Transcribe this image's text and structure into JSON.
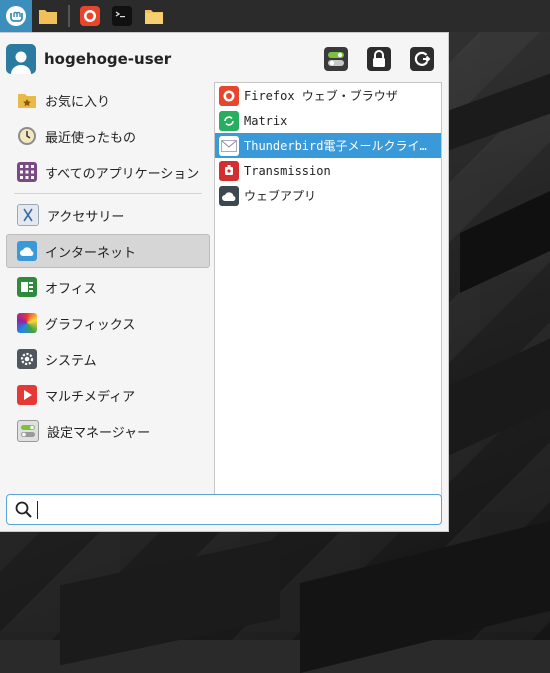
{
  "panel": {
    "icons": [
      "mint-menu-icon",
      "folder-icon",
      "firefox-icon",
      "terminal-icon",
      "folder-icon"
    ]
  },
  "user": {
    "name": "hogehoge-user"
  },
  "actions": [
    "settings-toggle-icon",
    "lock-icon",
    "logout-icon"
  ],
  "categories": [
    {
      "label": "お気に入り",
      "icon": "favorites-icon"
    },
    {
      "label": "最近使ったもの",
      "icon": "recent-icon"
    },
    {
      "label": "すべてのアプリケーション",
      "icon": "all-apps-icon"
    },
    {
      "label": "アクセサリー",
      "icon": "accessories-icon"
    },
    {
      "label": "インターネット",
      "icon": "internet-icon",
      "selected": true
    },
    {
      "label": "オフィス",
      "icon": "office-icon"
    },
    {
      "label": "グラフィックス",
      "icon": "graphics-icon"
    },
    {
      "label": "システム",
      "icon": "system-icon"
    },
    {
      "label": "マルチメディア",
      "icon": "multimedia-icon"
    },
    {
      "label": "設定マネージャー",
      "icon": "settings-manager-icon"
    }
  ],
  "apps": [
    {
      "label": "Firefox ウェブ・ブラウザ",
      "icon": "firefox-icon"
    },
    {
      "label": "Matrix",
      "icon": "matrix-icon"
    },
    {
      "label": "Thunderbird電子メールクライ…",
      "icon": "thunderbird-icon",
      "selected": true
    },
    {
      "label": "Transmission",
      "icon": "transmission-icon"
    },
    {
      "label": "ウェブアプリ",
      "icon": "webapps-icon"
    }
  ],
  "search": {
    "placeholder": "",
    "value": ""
  },
  "colors": {
    "accent": "#3a99d8",
    "panel": "#2b2b2b",
    "menu_bg": "#f5f5f5"
  }
}
